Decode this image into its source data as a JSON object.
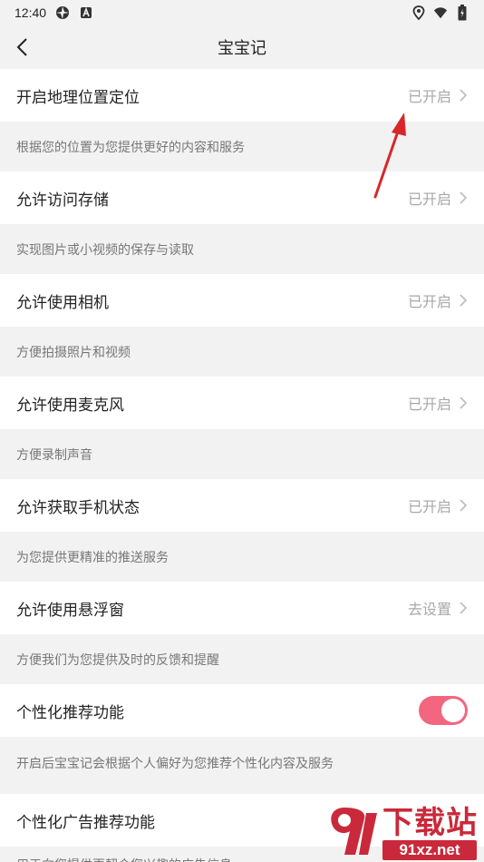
{
  "status_bar": {
    "time": "12:40",
    "left_icons": [
      "aperture-icon",
      "a-badge-icon"
    ],
    "right_icons": [
      "location-icon",
      "wifi-icon",
      "battery-icon"
    ]
  },
  "header": {
    "title": "宝宝记",
    "back_icon": "back-chevron-icon"
  },
  "settings": [
    {
      "label": "开启地理位置定位",
      "status": "已开启",
      "description": "根据您的位置为您提供更好的内容和服务"
    },
    {
      "label": "允许访问存储",
      "status": "已开启",
      "description": "实现图片或小视频的保存与读取"
    },
    {
      "label": "允许使用相机",
      "status": "已开启",
      "description": "方便拍摄照片和视频"
    },
    {
      "label": "允许使用麦克风",
      "status": "已开启",
      "description": "方便录制声音"
    },
    {
      "label": "允许获取手机状态",
      "status": "已开启",
      "description": "为您提供更精准的推送服务"
    },
    {
      "label": "允许使用悬浮窗",
      "status": "去设置",
      "description": "方便我们为您提供及时的反馈和提醒"
    }
  ],
  "personalization": {
    "label": "个性化推荐功能",
    "enabled": true,
    "description": "开启后宝宝记会根据个人偏好为您推荐个性化内容及服务"
  },
  "ad_personalization": {
    "label": "个性化广告推荐功能",
    "description": "用于向您提供更契合您兴趣的广告信息"
  },
  "watermark": {
    "text": "下载站",
    "url": "91xz.net"
  },
  "colors": {
    "toggle_on": "#f26680",
    "annotation_arrow": "#d6282b",
    "watermark": "#c9293a"
  }
}
